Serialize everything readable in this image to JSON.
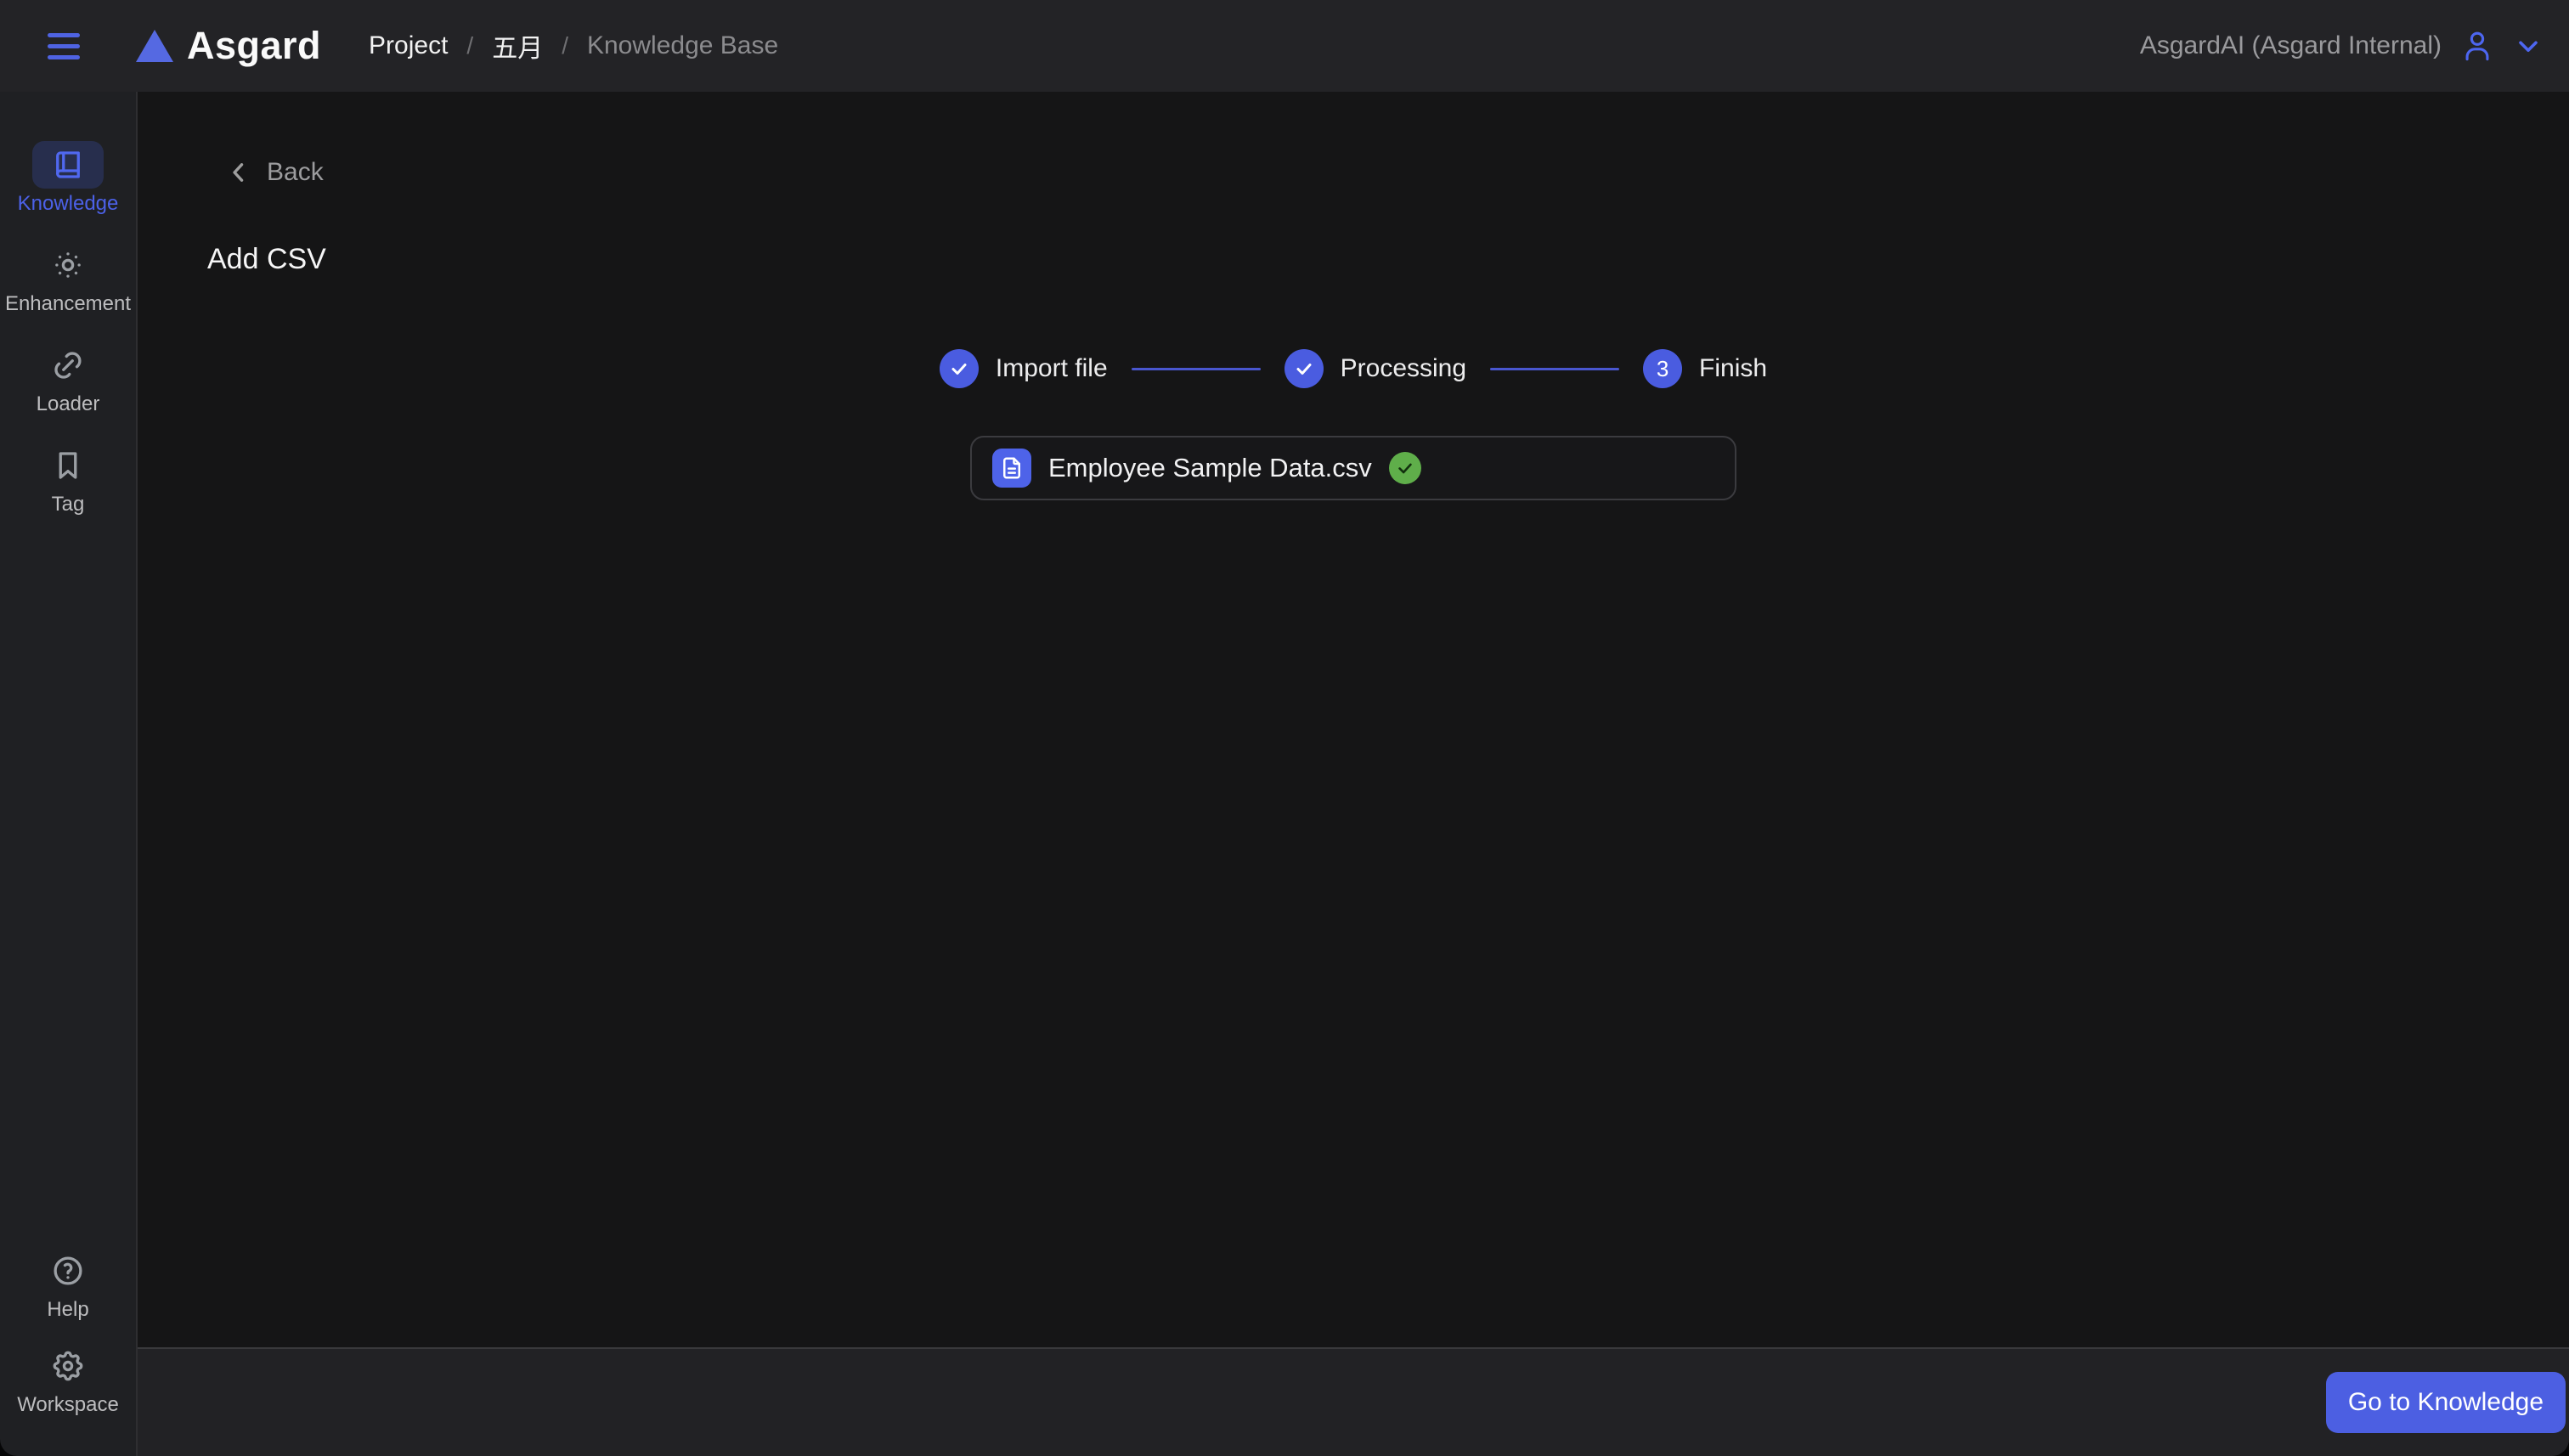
{
  "header": {
    "logo_text": "Asgard",
    "breadcrumb": {
      "root": "Project",
      "separator": "/",
      "project_name": "五月",
      "current_page": "Knowledge Base"
    },
    "account_label": "AsgardAI (Asgard Internal)"
  },
  "sidebar": {
    "items": [
      {
        "label": "Knowledge",
        "icon": "book-icon",
        "active": true
      },
      {
        "label": "Enhancement",
        "icon": "sun-icon",
        "active": false
      },
      {
        "label": "Loader",
        "icon": "link-icon",
        "active": false
      },
      {
        "label": "Tag",
        "icon": "bookmark-icon",
        "active": false
      }
    ],
    "bottom_items": [
      {
        "label": "Help",
        "icon": "question-circle-icon"
      },
      {
        "label": "Workspace",
        "icon": "gear-icon"
      }
    ]
  },
  "main": {
    "back_label": "Back",
    "title": "Add CSV",
    "stepper": {
      "steps": [
        {
          "label": "Import file",
          "status": "done"
        },
        {
          "label": "Processing",
          "status": "done"
        },
        {
          "label": "Finish",
          "status": "current",
          "number": "3"
        }
      ]
    },
    "file_card": {
      "filename": "Employee Sample Data.csv",
      "status": "success"
    }
  },
  "footer": {
    "primary_button_label": "Go to Knowledge"
  },
  "colors": {
    "accent_blue": "#4c5fe2",
    "active_item_bg": "#272e4d",
    "success_green": "#5fae4a",
    "header_bg": "#232326",
    "sidebar_bg": "#1f2023",
    "content_bg": "#151516",
    "footer_bg": "#222225"
  }
}
